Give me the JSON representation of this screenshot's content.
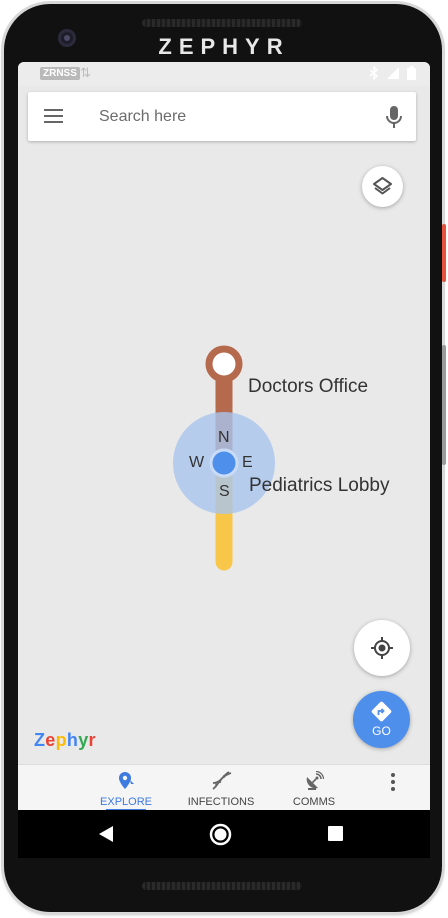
{
  "device": {
    "brand": "ZEPHYR"
  },
  "statusbar": {
    "carrier": "ZRNSS"
  },
  "search": {
    "placeholder": "Search here"
  },
  "map": {
    "places": [
      {
        "name": "Doctors Office"
      },
      {
        "name": "Pediatrics Lobby"
      }
    ],
    "compass": {
      "north": "N",
      "south": "S",
      "east": "E",
      "west": "W"
    },
    "colors": {
      "route_upper": "#b5694d",
      "route_lower": "#f8c74a",
      "location": "#4f8fec",
      "accuracy": "#a9c4ee"
    }
  },
  "buttons": {
    "go_label": "GO"
  },
  "watermark": {
    "letters": [
      {
        "ch": "Z",
        "color": "#4285f4"
      },
      {
        "ch": "e",
        "color": "#ea4335"
      },
      {
        "ch": "p",
        "color": "#fbbc05"
      },
      {
        "ch": "h",
        "color": "#4285f4"
      },
      {
        "ch": "y",
        "color": "#34a853"
      },
      {
        "ch": "r",
        "color": "#ea4335"
      }
    ]
  },
  "bottom_nav": {
    "items": [
      {
        "label": "EXPLORE",
        "icon": "location-pin-icon",
        "active": true
      },
      {
        "label": "INFECTIONS",
        "icon": "dna-icon",
        "active": false
      },
      {
        "label": "COMMS",
        "icon": "satellite-dish-icon",
        "active": false
      }
    ]
  }
}
